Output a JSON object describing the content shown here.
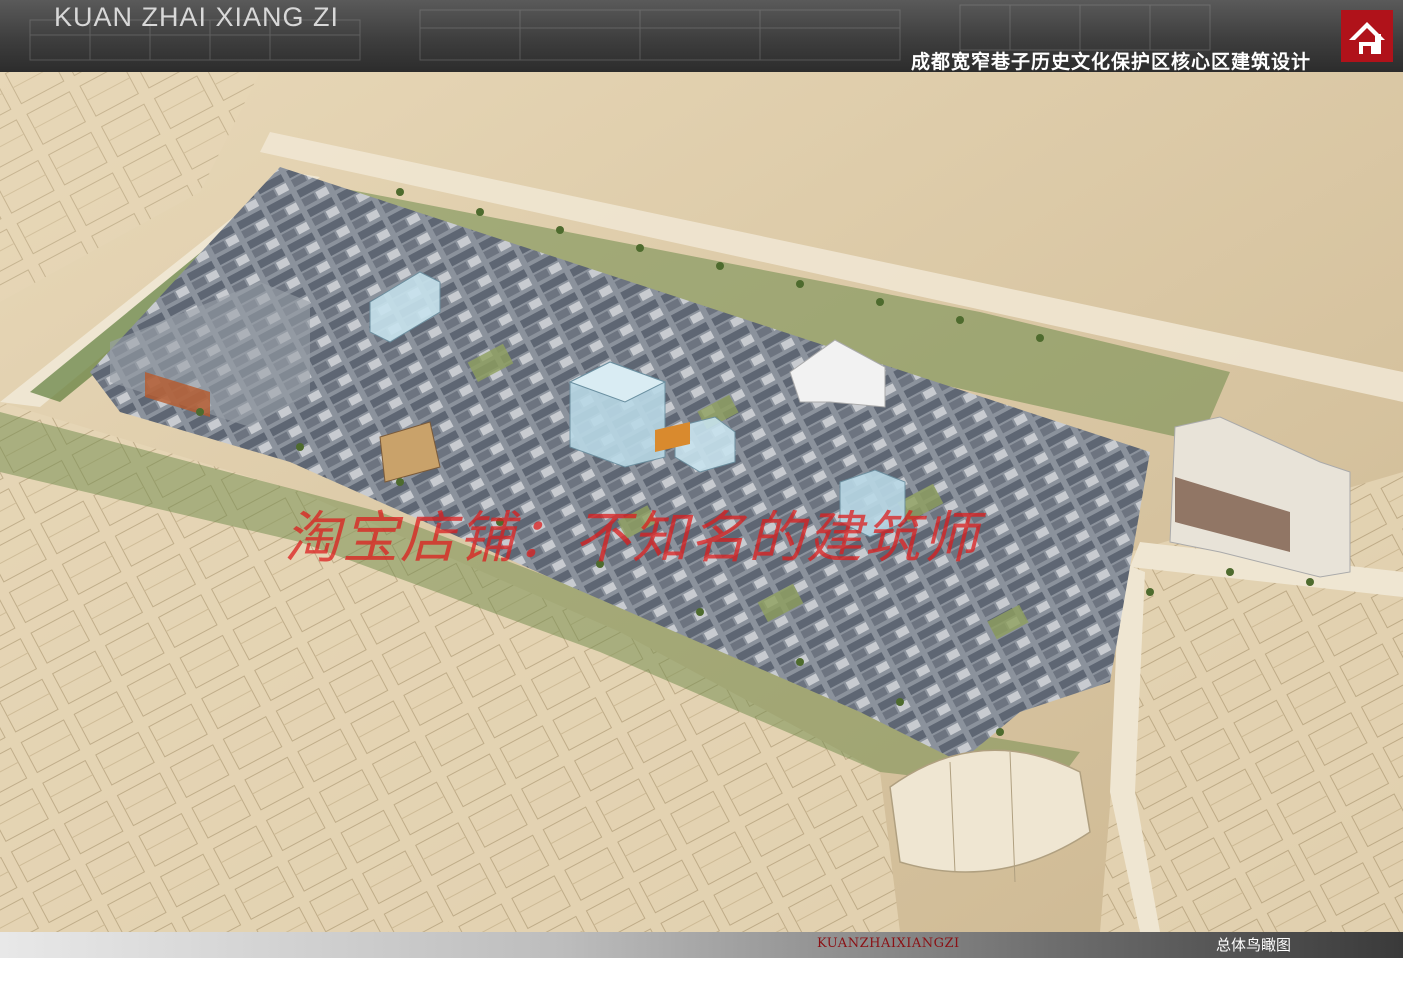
{
  "header": {
    "brand": "KUAN ZHAI XIANG ZI",
    "project_title": "成都宽窄巷子历史文化保护区核心区建筑设计"
  },
  "watermark": "淘宝店铺：不知名的建筑师",
  "footer": {
    "code": "KUANZHAIXIANGZI",
    "sheet_title": "总体鸟瞰图"
  },
  "colors": {
    "header_bg": "#3e3e3e",
    "brand_red": "#b0121a",
    "sand": "#ddc8a4",
    "roof_gray": "#5e6673",
    "glass": "#b9d9e6",
    "greenery": "#6e8a4a"
  },
  "icons": [
    "logo-icon"
  ]
}
